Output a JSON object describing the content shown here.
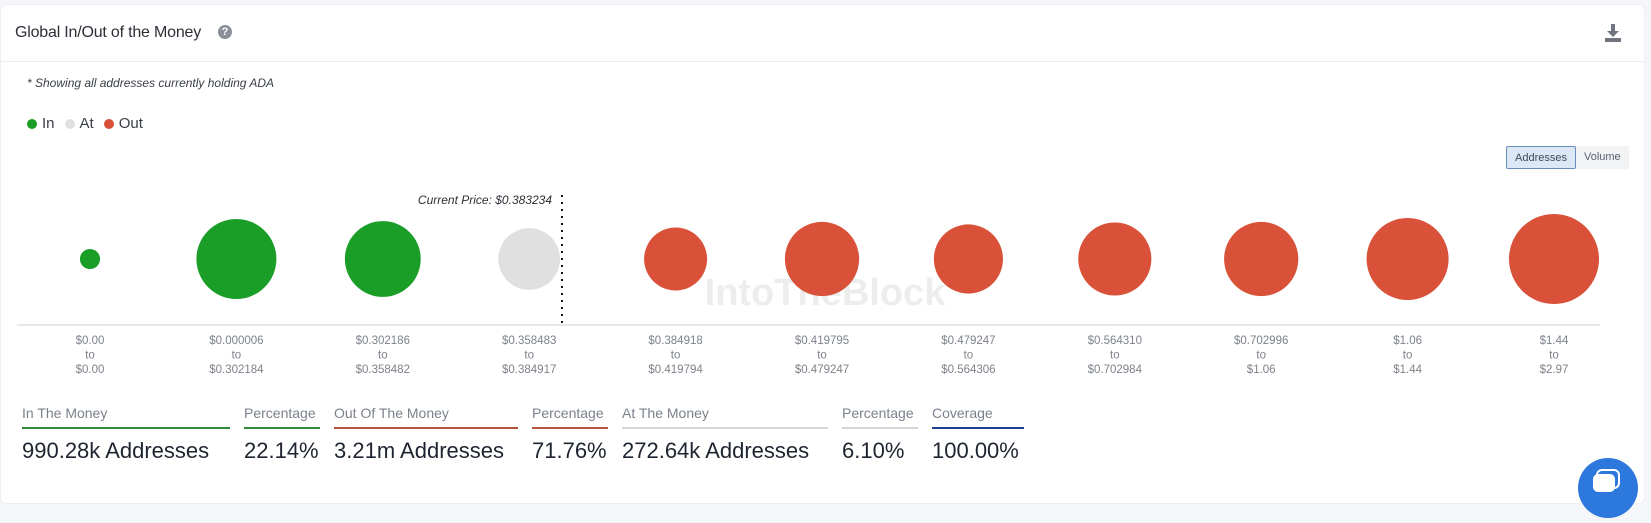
{
  "header": {
    "title": "Global In/Out of the Money",
    "help_icon": "question-circle-icon",
    "download_icon": "download-icon"
  },
  "note": "* Showing all addresses currently holding ADA",
  "legend": [
    {
      "label": "In",
      "color": "#1a9e28"
    },
    {
      "label": "At",
      "color": "#e0e0e0"
    },
    {
      "label": "Out",
      "color": "#d95139"
    }
  ],
  "toggle": {
    "addresses_label": "Addresses",
    "volume_label": "Volume",
    "selected": "Addresses"
  },
  "watermark": "IntoTheBlock",
  "chart_data": {
    "type": "scatter",
    "subtype": "bubble",
    "title": "Global In/Out of the Money",
    "current_price_label": "Current Price: $0.383234",
    "current_price": 0.383234,
    "size_metric": "Addresses (relative bubble size, estimated; no numeric labels shown)",
    "categories": [
      {
        "from": "$0.00",
        "to": "$0.00",
        "status": "In",
        "relative_size": 0.05
      },
      {
        "from": "$0.000006",
        "to": "$0.302184",
        "status": "In",
        "relative_size": 0.79
      },
      {
        "from": "$0.302186",
        "to": "$0.358482",
        "status": "In",
        "relative_size": 0.71
      },
      {
        "from": "$0.358483",
        "to": "$0.384917",
        "status": "At",
        "relative_size": 0.47
      },
      {
        "from": "$0.384918",
        "to": "$0.419794",
        "status": "Out",
        "relative_size": 0.49
      },
      {
        "from": "$0.419795",
        "to": "$0.479247",
        "status": "Out",
        "relative_size": 0.68
      },
      {
        "from": "$0.479247",
        "to": "$0.564306",
        "status": "Out",
        "relative_size": 0.59
      },
      {
        "from": "$0.564310",
        "to": "$0.702984",
        "status": "Out",
        "relative_size": 0.66
      },
      {
        "from": "$0.702996",
        "to": "$1.06",
        "status": "Out",
        "relative_size": 0.68
      },
      {
        "from": "$1.06",
        "to": "$1.44",
        "status": "Out",
        "relative_size": 0.83
      },
      {
        "from": "$1.44",
        "to": "$2.97",
        "status": "Out",
        "relative_size": 1.0
      }
    ],
    "range_connector": "to",
    "colors": {
      "In": "#1a9e28",
      "At": "#e0e0e0",
      "Out": "#d95139"
    }
  },
  "stats": [
    {
      "label": "In The Money",
      "value": "990.28k Addresses",
      "color": "#2e8b3a"
    },
    {
      "label": "Percentage",
      "value": "22.14%",
      "color": "#2e8b3a"
    },
    {
      "label": "Out Of The Money",
      "value": "3.21m Addresses",
      "color": "#b5553f"
    },
    {
      "label": "Percentage",
      "value": "71.76%",
      "color": "#b5553f"
    },
    {
      "label": "At The Money",
      "value": "272.64k Addresses",
      "color": "#d6d6d6"
    },
    {
      "label": "Percentage",
      "value": "6.10%",
      "color": "#d6d6d6"
    },
    {
      "label": "Coverage",
      "value": "100.00%",
      "color": "#1f3f8f"
    }
  ],
  "chat_icon": "chat-bubble-icon"
}
